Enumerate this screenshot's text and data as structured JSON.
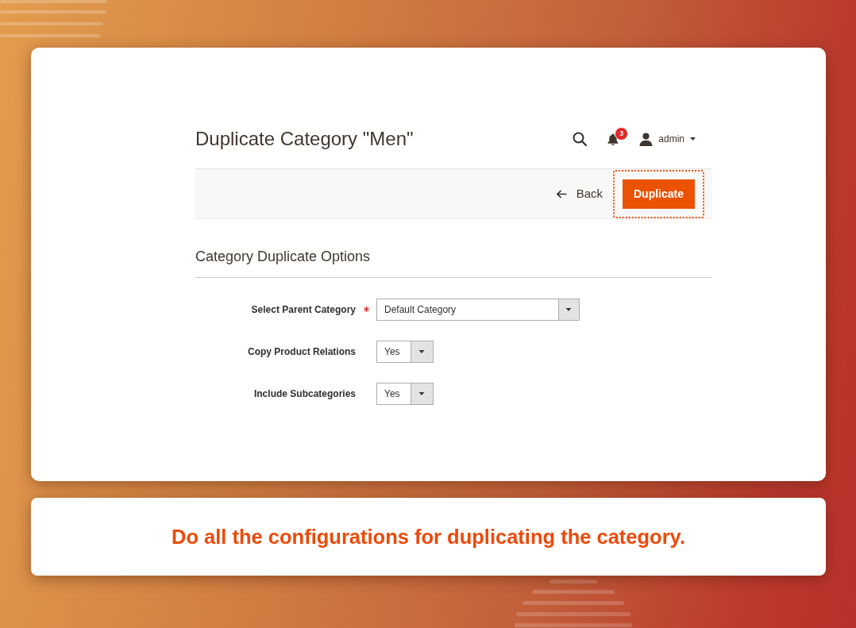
{
  "page": {
    "title": "Duplicate Category \"Men\""
  },
  "header": {
    "notifications": "3",
    "user": "admin"
  },
  "toolbar": {
    "buttons": [
      {
        "label": "Back",
        "kind": "back",
        "highlighted": false
      },
      {
        "label": "Duplicate",
        "kind": "primary",
        "highlighted": true
      }
    ]
  },
  "section": {
    "title": "Category Duplicate Options",
    "fields": [
      {
        "label": "Select Parent Category",
        "required": true,
        "value": "Default Category",
        "kind": "wide"
      },
      {
        "label": "Copy Product Relations",
        "required": false,
        "value": "Yes",
        "kind": "compact"
      },
      {
        "label": "Include Subcategories",
        "required": false,
        "value": "Yes",
        "kind": "compact"
      }
    ]
  },
  "caption": "Do all the configurations for duplicating the category."
}
